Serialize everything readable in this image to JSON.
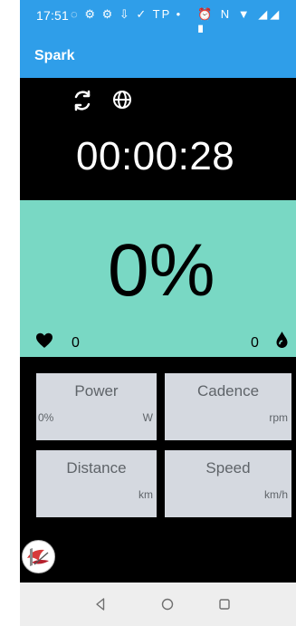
{
  "status_bar": {
    "time": "17:51",
    "left_icons": "◌ ⚙ ⚙ ⇩ ✓ TP •",
    "right_icons": "⏰ N ▼ ◢◢ ▮",
    "icon_names": [
      "sync-icon",
      "app-icon",
      "app-icon",
      "download-icon",
      "navigation-icon",
      "tp-icon",
      "dot-icon",
      "alarm-icon",
      "nfc-icon",
      "wifi-icon",
      "signal-icon",
      "battery-icon"
    ]
  },
  "app_bar": {
    "title": "Spark"
  },
  "session": {
    "elapsed_time": "00:00:28",
    "progress": "0%",
    "heart_rate": "0",
    "drop_count": "0"
  },
  "metrics": [
    {
      "label": "Power",
      "value": "0%",
      "unit": "W"
    },
    {
      "label": "Cadence",
      "value": "",
      "unit": "rpm"
    },
    {
      "label": "Distance",
      "value": "",
      "unit": "km"
    },
    {
      "label": "Speed",
      "value": "",
      "unit": "km/h"
    }
  ],
  "icons": {
    "sync": "sync-icon",
    "globe": "globe-icon",
    "heart": "heart-icon",
    "drop": "drop-icon",
    "logo": "app-logo-icon",
    "nav_back": "back-icon",
    "nav_home": "home-icon",
    "nav_recents": "recents-icon"
  },
  "colors": {
    "app_blue": "#2f9ee9",
    "progress_green": "#79d8c4",
    "metric_card": "#d5d9e0",
    "background_black": "#000000",
    "nav_gray": "#eeeeee"
  }
}
